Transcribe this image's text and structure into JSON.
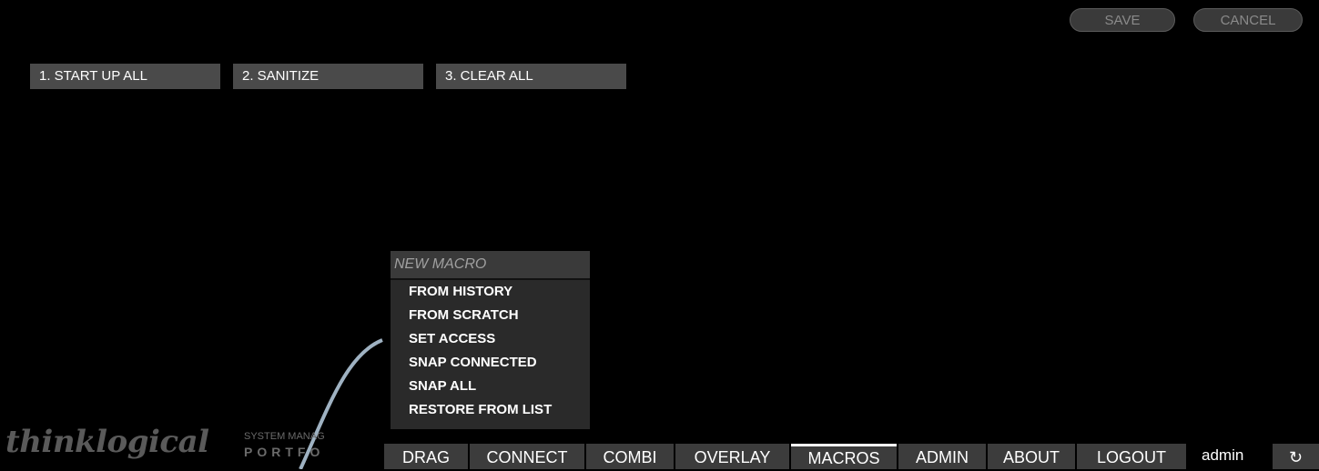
{
  "top_buttons": {
    "save": "SAVE",
    "cancel": "CANCEL"
  },
  "macros": [
    "1. START UP ALL",
    "2. SANITIZE",
    "3. CLEAR ALL"
  ],
  "menu": {
    "header": "NEW MACRO",
    "items": [
      "FROM HISTORY",
      "FROM SCRATCH",
      "SET ACCESS",
      "SNAP CONNECTED",
      "SNAP ALL",
      "RESTORE FROM LIST"
    ]
  },
  "logo": {
    "name": "thinklogical",
    "sub1": "SYSTEM MANAG",
    "sub2": "PORTFO"
  },
  "nav": [
    "DRAG",
    "CONNECT",
    "COMBI",
    "OVERLAY",
    "MACROS",
    "ADMIN",
    "ABOUT",
    "LOGOUT"
  ],
  "user": "admin",
  "refresh_icon": "↻"
}
